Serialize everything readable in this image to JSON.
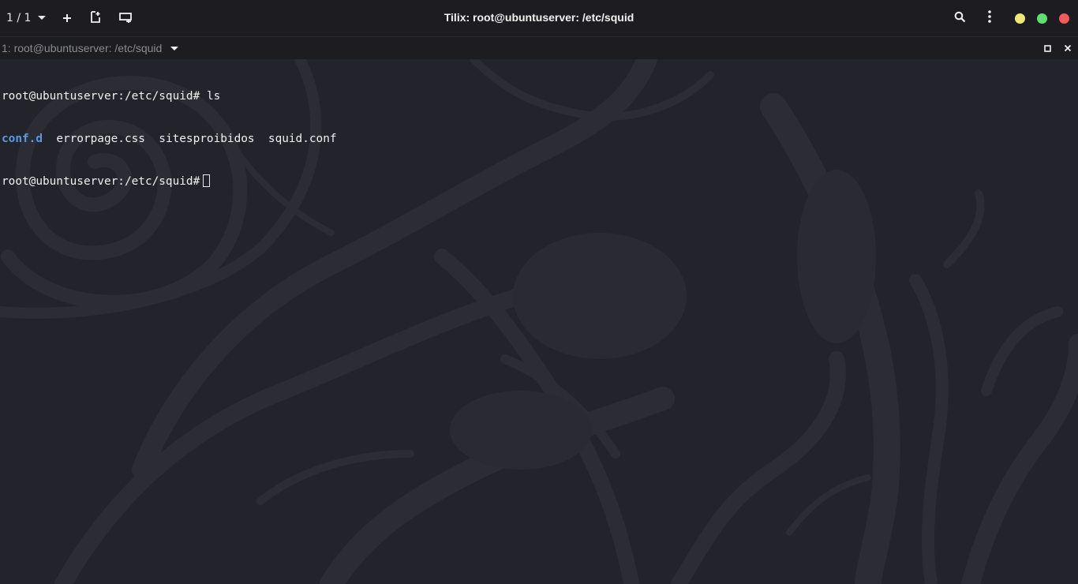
{
  "header": {
    "session_counter": "1 / 1",
    "title": "Tilix: root@ubuntuserver: /etc/squid",
    "icons": {
      "session_dropdown": "chevron-down-icon",
      "add": "plus-icon",
      "split": "split-terminal-icon",
      "sidebar": "sessions-sidebar-icon",
      "search": "search-icon",
      "menu": "kebab-menu-icon"
    },
    "window_controls": {
      "minimize_color": "#f0e875",
      "maximize_color": "#5ee070",
      "close_color": "#f25a5a"
    }
  },
  "terminal_bar": {
    "title": "1: root@ubuntuserver: /etc/squid",
    "icons": {
      "dropdown": "chevron-down-icon",
      "maximize": "maximize-icon",
      "close": "close-icon"
    }
  },
  "terminal": {
    "prompt": "root@ubuntuserver:/etc/squid#",
    "command": "ls",
    "listing": [
      "conf.d",
      "errorpage.css",
      "sitesproibidos",
      "squid.conf"
    ],
    "directory_color": "#5a9ae0",
    "text_color": "#f0f0f0",
    "background_color": "#23232b"
  }
}
